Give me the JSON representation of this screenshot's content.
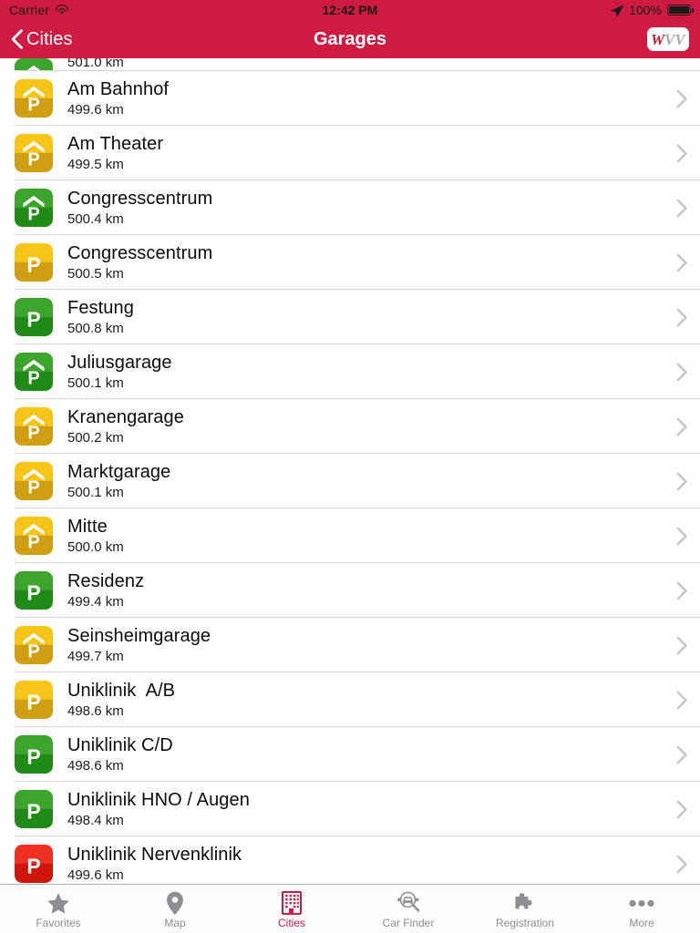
{
  "statusbar": {
    "carrier": "Carrier",
    "wifi_icon": "wifi-icon",
    "time": "12:42 PM",
    "location_icon": "location-arrow-icon",
    "battery_percent": "100%",
    "battery_icon": "battery-full-icon"
  },
  "navbar": {
    "back_icon": "chevron-left-icon",
    "back_label": "Cities",
    "title": "Garages",
    "logo_text": "WVV",
    "logo_primary_color": "#d1182f",
    "logo_secondary_color": "#a9a9ad"
  },
  "colors": {
    "brand_red": "#cf1b41",
    "icon_green_top": "#3ba62b",
    "icon_green_bottom": "#1f8b16",
    "icon_yellow_top": "#f6c518",
    "icon_yellow_bottom": "#cf9f11",
    "icon_red_top": "#ee3123",
    "icon_red_bottom": "#cf160c",
    "separator": "#d4d4d6",
    "tab_inactive": "#8e8e93"
  },
  "list": {
    "rows": [
      {
        "title": "",
        "distance": "501.0 km",
        "icon": "parking-garage-icon",
        "color": "green",
        "roof": true,
        "clipped": true
      },
      {
        "title": "Am Bahnhof",
        "distance": "499.6 km",
        "icon": "parking-garage-icon",
        "color": "yellow",
        "roof": true,
        "clipped": false
      },
      {
        "title": "Am Theater",
        "distance": "499.5 km",
        "icon": "parking-garage-icon",
        "color": "yellow",
        "roof": true,
        "clipped": false
      },
      {
        "title": "Congresscentrum",
        "distance": "500.4 km",
        "icon": "parking-garage-icon",
        "color": "green",
        "roof": true,
        "clipped": false
      },
      {
        "title": "Congresscentrum",
        "distance": "500.5 km",
        "icon": "parking-lot-icon",
        "color": "yellow",
        "roof": false,
        "clipped": false
      },
      {
        "title": "Festung",
        "distance": "500.8 km",
        "icon": "parking-lot-icon",
        "color": "green",
        "roof": false,
        "clipped": false
      },
      {
        "title": "Juliusgarage",
        "distance": "500.1 km",
        "icon": "parking-garage-icon",
        "color": "green",
        "roof": true,
        "clipped": false
      },
      {
        "title": "Kranengarage",
        "distance": "500.2 km",
        "icon": "parking-garage-icon",
        "color": "yellow",
        "roof": true,
        "clipped": false
      },
      {
        "title": "Marktgarage",
        "distance": "500.1 km",
        "icon": "parking-garage-icon",
        "color": "yellow",
        "roof": true,
        "clipped": false
      },
      {
        "title": "Mitte",
        "distance": "500.0 km",
        "icon": "parking-garage-icon",
        "color": "yellow",
        "roof": true,
        "clipped": false
      },
      {
        "title": "Residenz",
        "distance": "499.4 km",
        "icon": "parking-lot-icon",
        "color": "green",
        "roof": false,
        "clipped": false
      },
      {
        "title": "Seinsheimgarage",
        "distance": "499.7 km",
        "icon": "parking-garage-icon",
        "color": "yellow",
        "roof": true,
        "clipped": false
      },
      {
        "title": "Uniklinik  A/B",
        "distance": "498.6 km",
        "icon": "parking-lot-icon",
        "color": "yellow",
        "roof": false,
        "clipped": false
      },
      {
        "title": "Uniklinik C/D",
        "distance": "498.6 km",
        "icon": "parking-lot-icon",
        "color": "green",
        "roof": false,
        "clipped": false
      },
      {
        "title": "Uniklinik HNO / Augen",
        "distance": "498.4 km",
        "icon": "parking-lot-icon",
        "color": "green",
        "roof": false,
        "clipped": false
      },
      {
        "title": "Uniklinik Nervenklinik",
        "distance": "499.6 km",
        "icon": "parking-lot-icon",
        "color": "red",
        "roof": false,
        "clipped": false
      }
    ],
    "disclosure_icon": "chevron-right-icon"
  },
  "tabbar": {
    "items": [
      {
        "label": "Favorites",
        "icon": "star-icon",
        "active": false
      },
      {
        "label": "Map",
        "icon": "map-pin-icon",
        "active": false
      },
      {
        "label": "Cities",
        "icon": "building-icon",
        "active": true
      },
      {
        "label": "Car Finder",
        "icon": "car-search-icon",
        "active": false
      },
      {
        "label": "Registration",
        "icon": "puzzle-piece-icon",
        "active": false
      },
      {
        "label": "More",
        "icon": "ellipsis-icon",
        "active": false
      }
    ]
  }
}
